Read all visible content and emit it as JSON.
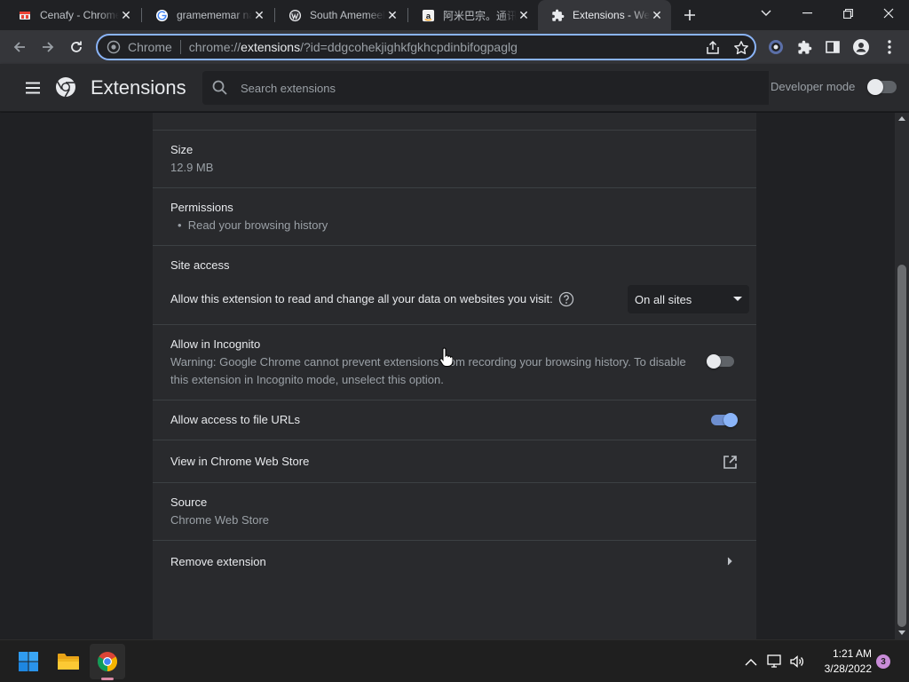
{
  "browser": {
    "tabs": [
      {
        "title": "Cenafy - Chrome",
        "icon": "cenafy-favicon",
        "active": false
      },
      {
        "title": "gramememar na",
        "icon": "google-favicon",
        "active": false
      },
      {
        "title": "South Amemeel",
        "icon": "wordpress-favicon",
        "active": false
      },
      {
        "title": "阿米巴宗。通讯",
        "icon": "amazon-favicon",
        "active": false
      },
      {
        "title": "Extensions - We",
        "icon": "puzzle-favicon",
        "active": true
      }
    ],
    "omnibox": {
      "chip": "Chrome",
      "url_prefix": "chrome://",
      "url_host": "extensions",
      "url_rest": "/?id=ddgcohekjighkfgkhcpdinbifogpaglg"
    }
  },
  "header": {
    "title": "Extensions",
    "search_placeholder": "Search extensions",
    "developer_mode_label": "Developer mode",
    "developer_mode_on": false
  },
  "details": {
    "size": {
      "label": "Size",
      "value": "12.9 MB"
    },
    "permissions": {
      "label": "Permissions",
      "items": [
        "Read your browsing history"
      ]
    },
    "site_access": {
      "label": "Site access",
      "description": "Allow this extension to read and change all your data on websites you visit:",
      "selected": "On all sites"
    },
    "incognito": {
      "label": "Allow in Incognito",
      "warning_line1": "Warning: Google Chrome cannot prevent extensions from recording your browsing history. To disable",
      "warning_line2": "this extension in Incognito mode, unselect this option.",
      "enabled": false
    },
    "file_urls": {
      "label": "Allow access to file URLs",
      "enabled": true
    },
    "web_store": {
      "label": "View in Chrome Web Store"
    },
    "source": {
      "label": "Source",
      "value": "Chrome Web Store"
    },
    "remove": {
      "label": "Remove extension"
    }
  },
  "taskbar": {
    "time": "1:21 AM",
    "date": "3/28/2022",
    "notification_count": "3"
  },
  "colors": {
    "accent": "#8ab4f8",
    "page_bg": "#202124",
    "card_bg": "#292a2d"
  }
}
